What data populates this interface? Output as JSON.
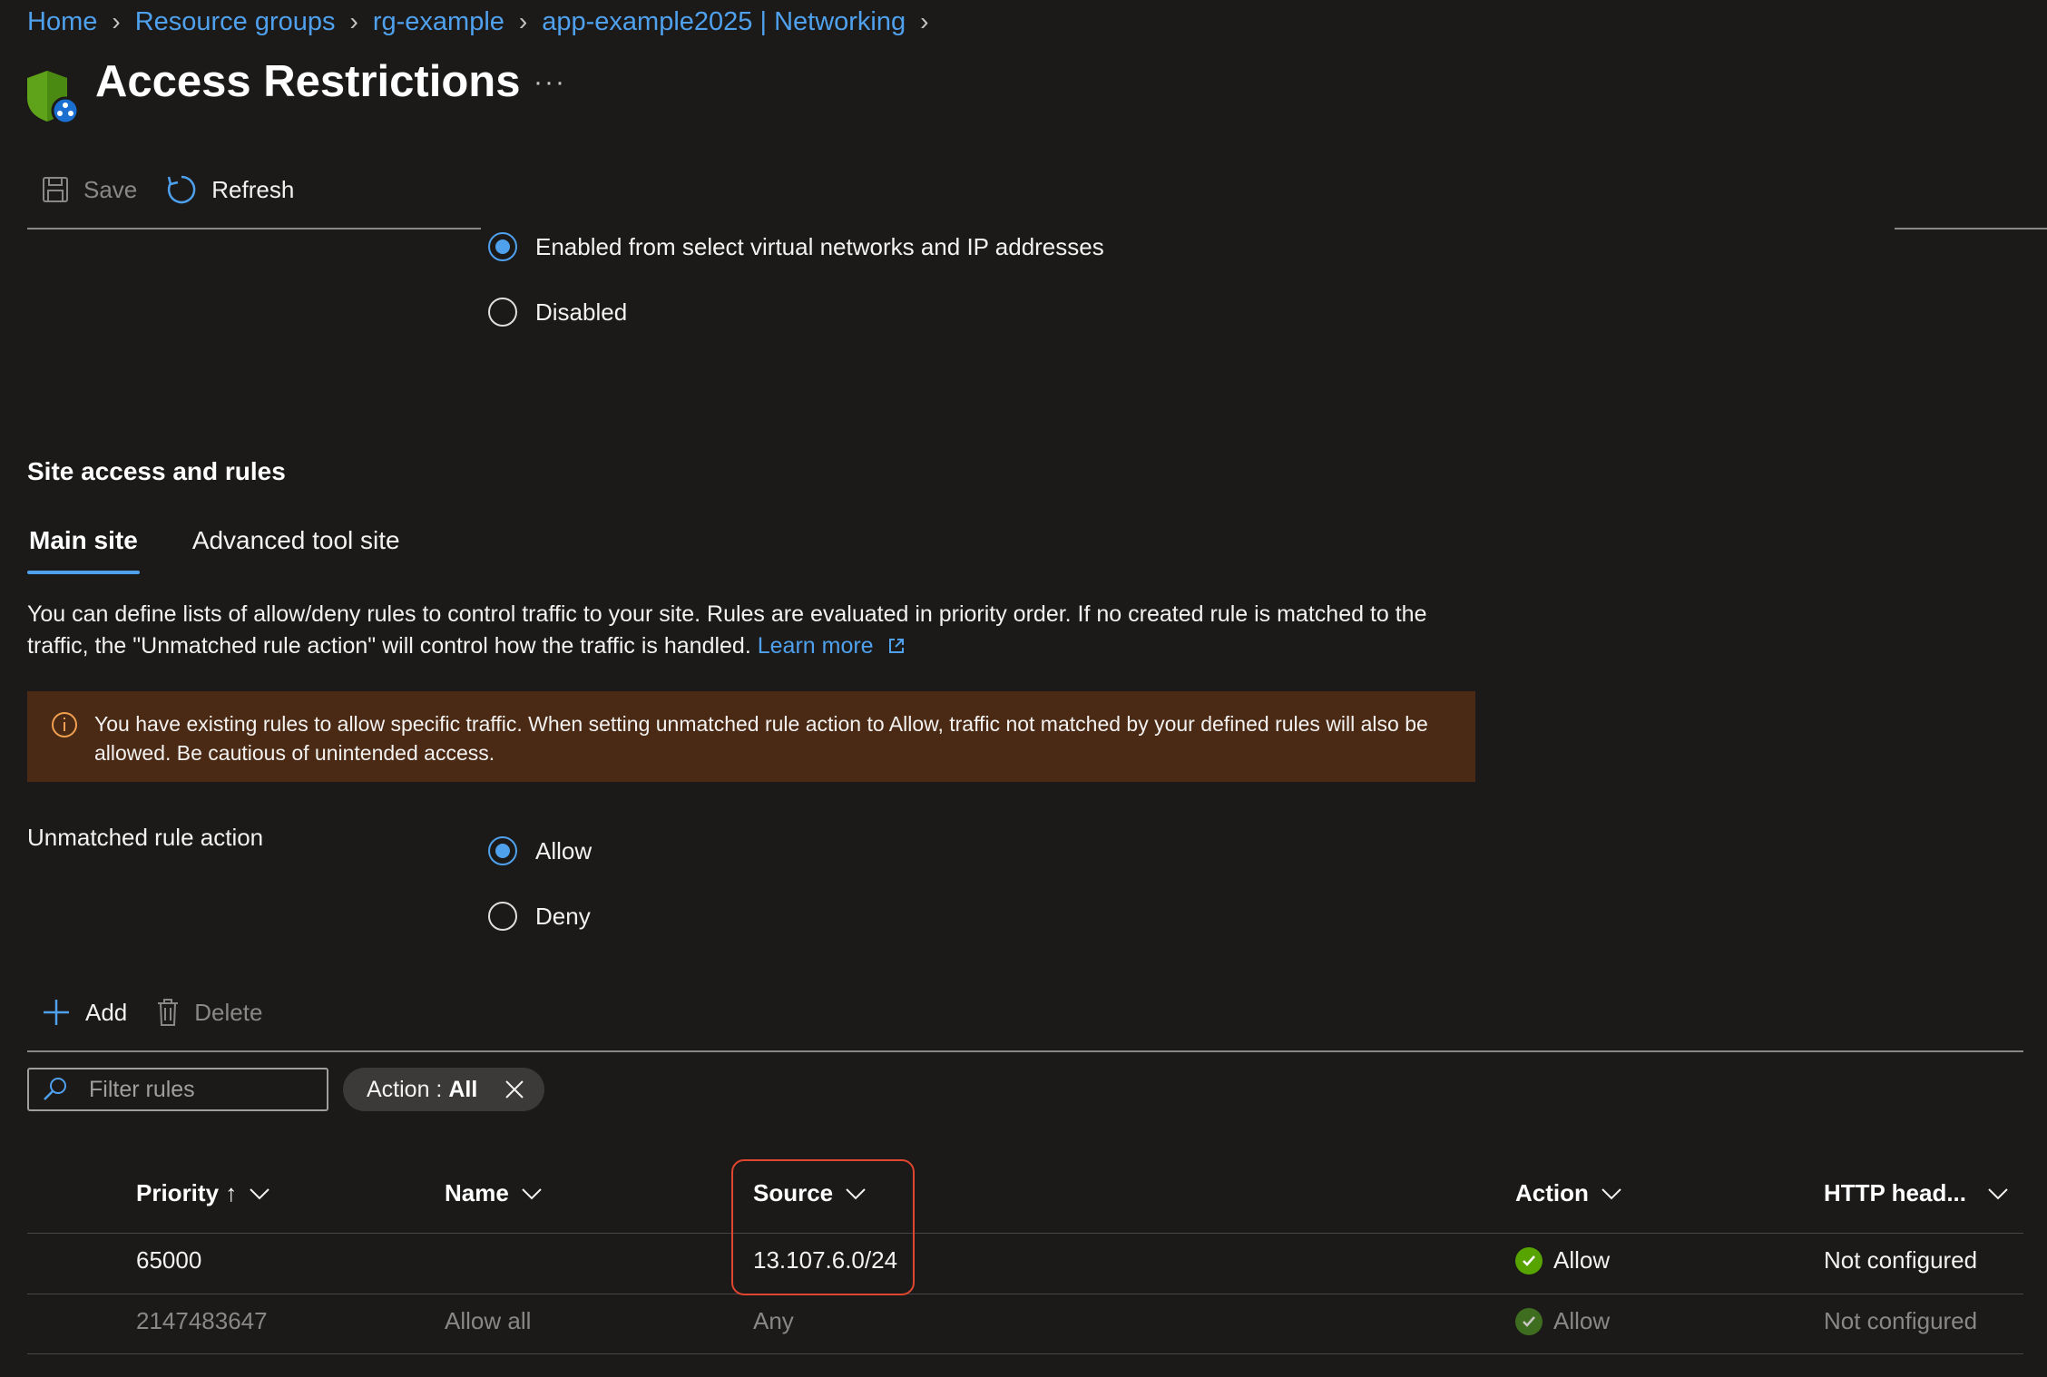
{
  "breadcrumb": [
    "Home",
    "Resource groups",
    "rg-example",
    "app-example2025 | Networking"
  ],
  "page": {
    "title": "Access Restrictions",
    "more": "···"
  },
  "toolbar": {
    "save": "Save",
    "refresh": "Refresh"
  },
  "public_access": {
    "options": [
      "Enabled from select virtual networks and IP addresses",
      "Disabled"
    ],
    "selected": 0
  },
  "section_title": "Site access and rules",
  "tabs": [
    "Main site",
    "Advanced tool site"
  ],
  "description": "You can define lists of allow/deny rules to control traffic to your site. Rules are evaluated in priority order. If no created rule is matched to the traffic, the \"Unmatched rule action\" will control how the traffic is handled.",
  "learn_more": "Learn more",
  "warning": "You have existing rules to allow specific traffic. When setting unmatched rule action to Allow, traffic not matched by your defined rules will also be allowed. Be cautious of unintended access.",
  "unmatched": {
    "label": "Unmatched rule action",
    "options": [
      "Allow",
      "Deny"
    ],
    "selected": 0
  },
  "rule_actions": {
    "add": "Add",
    "delete": "Delete"
  },
  "filter": {
    "placeholder": "Filter rules",
    "pill_key": "Action : ",
    "pill_value": "All"
  },
  "table": {
    "columns": [
      "Priority ↑",
      "Name",
      "Source",
      "Action",
      "HTTP head..."
    ],
    "rows": [
      {
        "priority": "65000",
        "name": "",
        "source": "13.107.6.0/24",
        "action": "Allow",
        "http": "Not configured"
      },
      {
        "priority": "2147483647",
        "name": "Allow all",
        "source": "Any",
        "action": "Allow",
        "http": "Not configured"
      }
    ]
  },
  "colors": {
    "accent": "#4fa1ee",
    "warning_bg": "#4a2a14",
    "highlight": "#e0452f",
    "allow": "#57a300"
  }
}
